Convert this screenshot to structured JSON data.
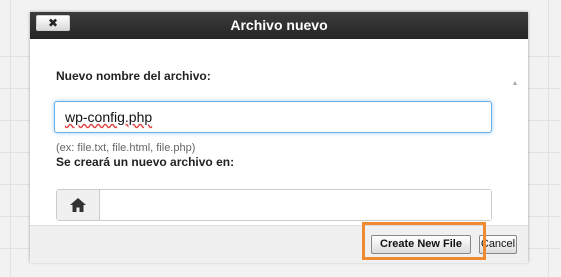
{
  "dialog": {
    "title": "Archivo nuevo",
    "close_label": "✖"
  },
  "form": {
    "filename_label": "Nuevo nombre del archivo:",
    "filename_value": "wp-config.php",
    "filename_hint": "(ex: file.txt, file.html, file.php)",
    "location_label": "Se creará un nuevo archivo en:",
    "location_value": "",
    "home_icon": "home-icon"
  },
  "footer": {
    "create_label": "Create New File",
    "cancel_label": "Cancel"
  },
  "colors": {
    "titlebar": "#262626",
    "focus_border": "#66afe9",
    "highlight": "#f08a30"
  }
}
